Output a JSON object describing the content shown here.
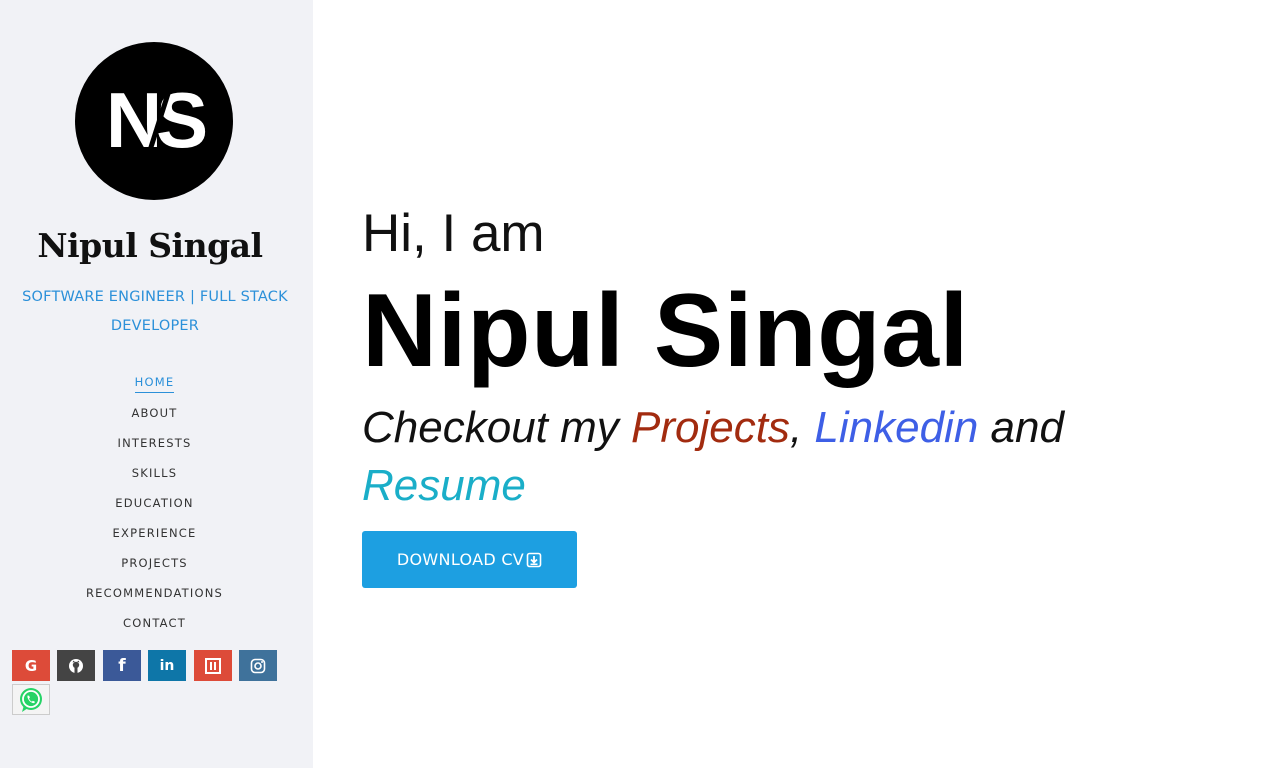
{
  "profile": {
    "logo_text": "NS",
    "name": "Nipul Singal",
    "role": "SOFTWARE ENGINEER | FULL STACK DEVELOPER"
  },
  "nav": {
    "items": [
      {
        "label": "HOME",
        "active": true
      },
      {
        "label": "ABOUT"
      },
      {
        "label": "INTERESTS"
      },
      {
        "label": "SKILLS"
      },
      {
        "label": "EDUCATION"
      },
      {
        "label": "EXPERIENCE"
      },
      {
        "label": "PROJECTS"
      },
      {
        "label": "RECOMMENDATIONS"
      },
      {
        "label": "CONTACT"
      }
    ]
  },
  "social": [
    {
      "icon": "google-icon",
      "glyph": "G",
      "color": "#dd4b39"
    },
    {
      "icon": "github-icon",
      "color": "#444444"
    },
    {
      "icon": "facebook-icon",
      "glyph": "f",
      "color": "#3b5998"
    },
    {
      "icon": "linkedin-icon",
      "glyph": "in",
      "color": "#0e76a8"
    },
    {
      "icon": "blogger-icon",
      "color": "#dd4b39"
    },
    {
      "icon": "instagram-icon",
      "color": "#3f729b"
    },
    {
      "icon": "whatsapp-icon",
      "color": "#25d366"
    }
  ],
  "hero": {
    "greeting": "Hi, I am",
    "name": "Nipul Singal",
    "checkout_prefix": "Checkout my ",
    "projects_link": "Projects",
    "comma": ", ",
    "linkedin_link": "Linkedin",
    "and": " and ",
    "resume_link": "Resume",
    "download_label": "DOWNLOAD CV"
  },
  "colors": {
    "accent": "#2b90d9",
    "projects_link": "#a22b0f",
    "linkedin_link": "#3e5fe6",
    "resume_link": "#1aaec8",
    "download_button": "#1d9fe1",
    "sidebar_bg": "#f1f2f6"
  }
}
